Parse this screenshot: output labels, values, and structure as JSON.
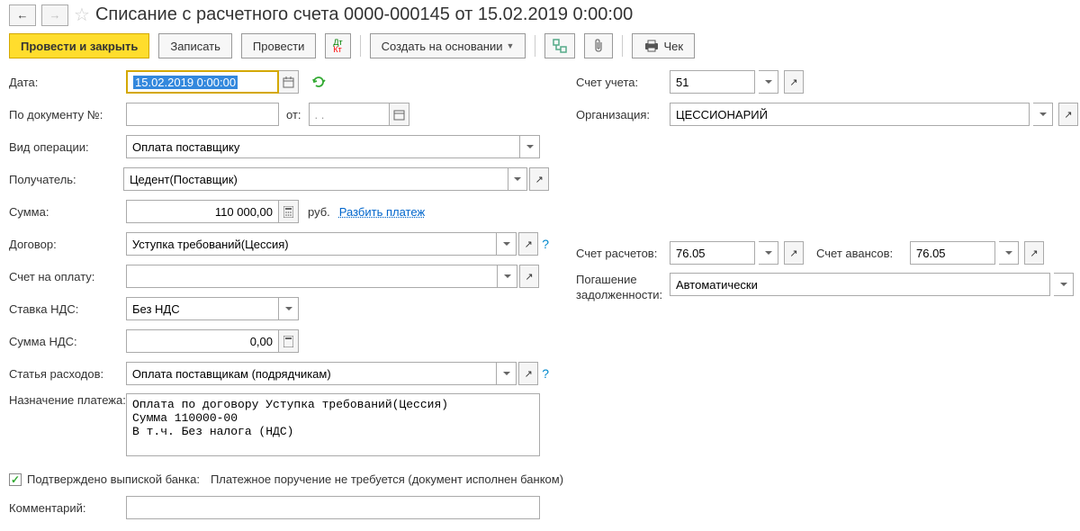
{
  "header": {
    "title": "Списание с расчетного счета 0000-000145 от 15.02.2019 0:00:00"
  },
  "toolbar": {
    "post_close": "Провести и закрыть",
    "save": "Записать",
    "post": "Провести",
    "create_basis": "Создать на основании",
    "cheque": "Чек"
  },
  "form": {
    "date_label": "Дата:",
    "date_value": "15.02.2019  0:00:00",
    "doc_num_label": "По документу №:",
    "doc_num_value": "",
    "from_label": "от:",
    "from_value": ". .",
    "op_type_label": "Вид операции:",
    "op_type_value": "Оплата поставщику",
    "recipient_label": "Получатель:",
    "recipient_value": "Цедент(Поставщик)",
    "amount_label": "Сумма:",
    "amount_value": "110 000,00",
    "currency": "руб.",
    "split_link": "Разбить платеж",
    "contract_label": "Договор:",
    "contract_value": "Уступка требований(Цессия)",
    "invoice_label": "Счет на оплату:",
    "invoice_value": "",
    "vat_rate_label": "Ставка НДС:",
    "vat_rate_value": "Без НДС",
    "vat_amount_label": "Сумма НДС:",
    "vat_amount_value": "0,00",
    "expense_label": "Статья расходов:",
    "expense_value": "Оплата поставщикам (подрядчикам)",
    "purpose_label": "Назначение платежа:",
    "purpose_value": "Оплата по договору Уступка требований(Цессия)\nСумма 110000-00\nВ т.ч. Без налога (НДС)",
    "confirmed_label": "Подтверждено выпиской банка:",
    "confirmed_note": "Платежное поручение не требуется (документ исполнен банком)",
    "comment_label": "Комментарий:"
  },
  "right": {
    "account_label": "Счет учета:",
    "account_value": "51",
    "org_label": "Организация:",
    "org_value": "ЦЕССИОНАРИЙ",
    "settle_account_label": "Счет расчетов:",
    "settle_account_value": "76.05",
    "advance_account_label": "Счет авансов:",
    "advance_account_value": "76.05",
    "debt_label": "Погашение задолженности:",
    "debt_value": "Автоматически"
  }
}
